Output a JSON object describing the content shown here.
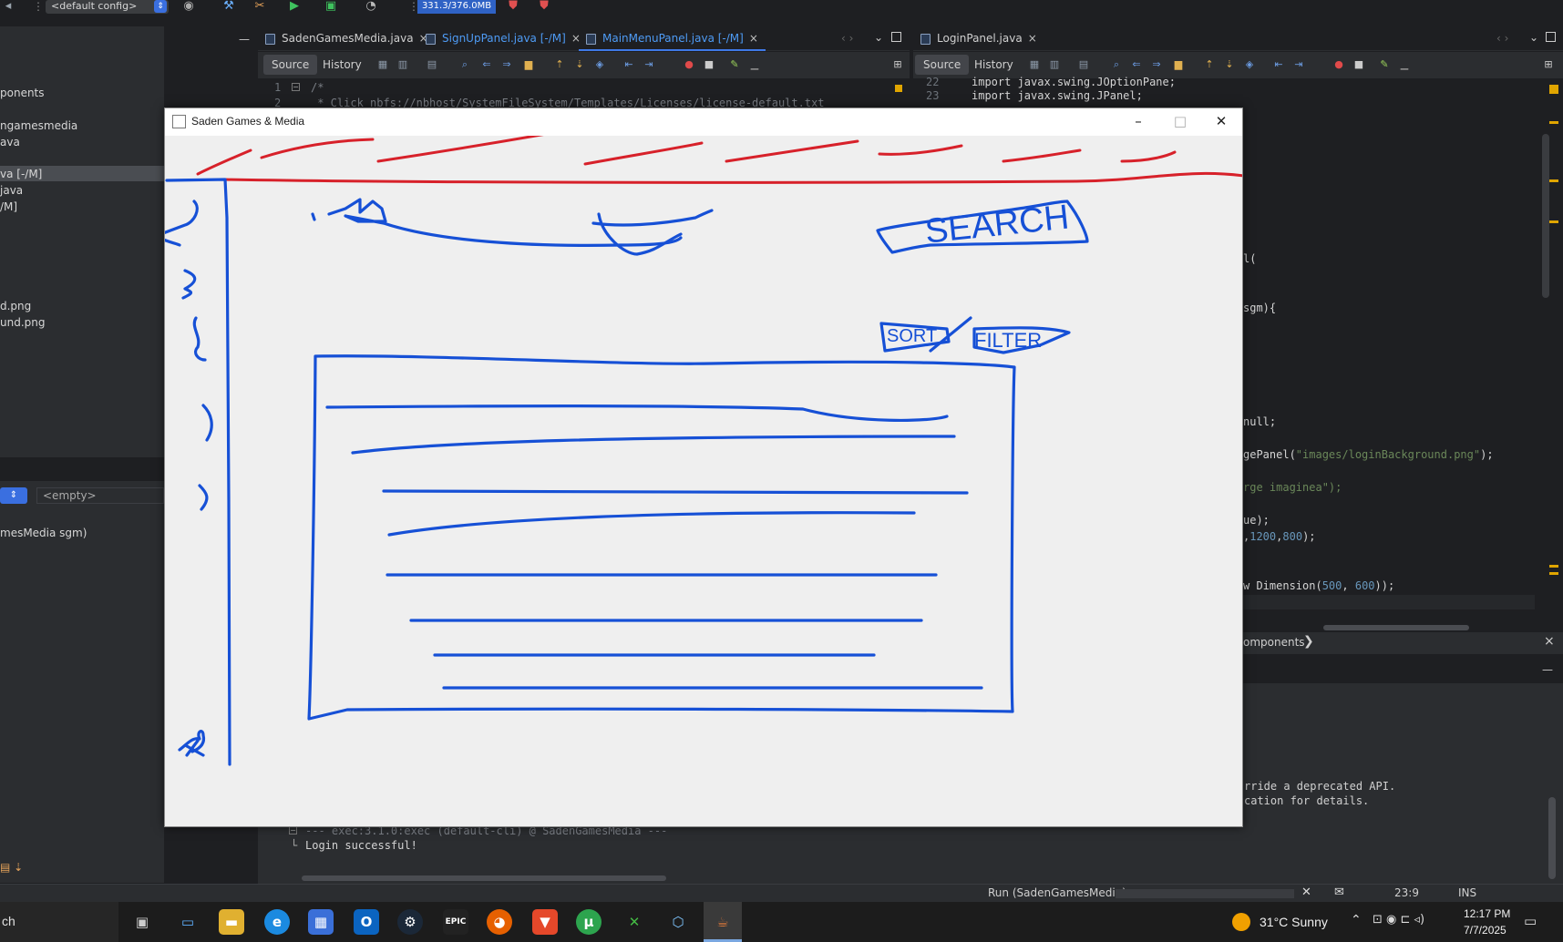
{
  "toolbar": {
    "config": "<default config>",
    "memory": "331.3/376.0MB"
  },
  "left_editor": {
    "tabs": [
      {
        "label": "SadenGamesMedia.java",
        "close": "×"
      },
      {
        "label": "SignUpPanel.java [-/M]",
        "close": "×"
      },
      {
        "label": "MainMenuPanel.java [-/M]",
        "close": "×"
      }
    ],
    "source_label": "Source",
    "history_label": "History",
    "line_numbers": [
      "1",
      "2"
    ],
    "code_lines": [
      "/*",
      " * Click nbfs://nbhost/SystemFileSystem/Templates/Licenses/license-default.txt"
    ]
  },
  "right_editor": {
    "tabs": [
      {
        "label": "LoginPanel.java",
        "close": "×"
      }
    ],
    "source_label": "Source",
    "history_label": "History",
    "line_numbers": [
      "22",
      "23"
    ],
    "code_top": [
      "import javax.swing.JOptionPane;",
      "import javax.swing.JPanel;"
    ],
    "code_fragments": {
      "f1": "l(",
      "f2": "sgm){",
      "f3": "null;",
      "f4_a": "gePanel(",
      "f4_b": "\"images/loginBackground.png\"",
      "f4_c": ");",
      "f5": "rge imaginea\");",
      "f6": "ue);",
      "f7_a": ",",
      "f7_b": "1200",
      "f7_c": ",",
      "f7_d": "800",
      "f7_e": ");",
      "f8_a": "w Dimension(",
      "f8_b": "500",
      "f8_c": ", ",
      "f8_d": "600",
      "f8_e": "));"
    },
    "components_label": "omponents",
    "close": "×"
  },
  "project": {
    "lines": [
      "ponents",
      "ngamesmedia",
      "ava",
      "va [-/M]",
      "java",
      "/M]",
      "d.png",
      "und.png"
    ],
    "empty_label": "<empty>",
    "method_label": "mesMedia sgm)"
  },
  "output": {
    "line1": "--- exec:3.1.0:exec (default-cli) @ SadenGamesMedia ---",
    "line2": "Login successful!",
    "right1": "rride a deprecated API.",
    "right2": "cation for details."
  },
  "status": {
    "run_label": "Run (SadenGamesMedia)",
    "position": "23:9",
    "mode": "INS"
  },
  "taskbar": {
    "search": "ch",
    "weather": "31°C  Sunny",
    "time": "12:17 PM",
    "date": "7/7/2025"
  },
  "swing_window": {
    "title": "Saden Games & Media",
    "minimize": "–",
    "maximize": "□",
    "close": "✕",
    "sketch_text": {
      "search": "SEARCH",
      "sort": "SORT",
      "filter": "FILTER"
    }
  },
  "colors": {
    "red_ink": "#d7212a",
    "blue_ink": "#1650d6",
    "accent": "#3f7ae8"
  }
}
